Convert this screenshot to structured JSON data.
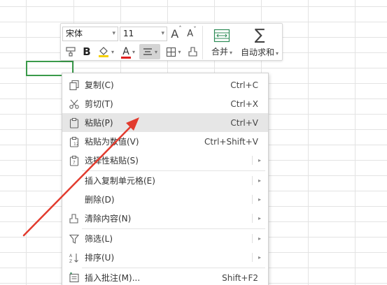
{
  "toolbar": {
    "font_name": "宋体",
    "font_size": "11",
    "grow_font_glyph": "A",
    "shrink_font_glyph": "A",
    "bold_glyph": "B",
    "font_color_glyph": "A",
    "merge_label": "合并",
    "autosum_label": "自动求和",
    "autosum_glyph": "∑",
    "font_color": "#e02020",
    "fill_color": "#f5d000"
  },
  "menu": {
    "items": [
      {
        "label": "复制(C)",
        "shortcut": "Ctrl+C",
        "icon": "copy-icon"
      },
      {
        "label": "剪切(T)",
        "shortcut": "Ctrl+X",
        "icon": "scissors-icon"
      },
      {
        "label": "粘贴(P)",
        "shortcut": "Ctrl+V",
        "icon": "paste-icon"
      },
      {
        "label": "粘贴为数值(V)",
        "shortcut": "Ctrl+Shift+V",
        "icon": "paste-values-icon"
      },
      {
        "label": "选择性粘贴(S)",
        "shortcut": "",
        "icon": "paste-special-icon"
      },
      {
        "label": "插入复制单元格(E)",
        "shortcut": "",
        "icon": ""
      },
      {
        "label": "删除(D)",
        "shortcut": "",
        "icon": ""
      },
      {
        "label": "清除内容(N)",
        "shortcut": "",
        "icon": "eraser-icon"
      },
      {
        "label": "筛选(L)",
        "shortcut": "",
        "icon": "filter-icon"
      },
      {
        "label": "排序(U)",
        "shortcut": "",
        "icon": "sort-icon"
      },
      {
        "label": "插入批注(M)...",
        "shortcut": "Shift+F2",
        "icon": "comment-icon"
      }
    ],
    "hovered_index": 2
  },
  "colors": {
    "selection_border": "#3a9a4a",
    "annotation_arrow": "#e23b2e",
    "menu_hover": "#e6e6e6"
  }
}
